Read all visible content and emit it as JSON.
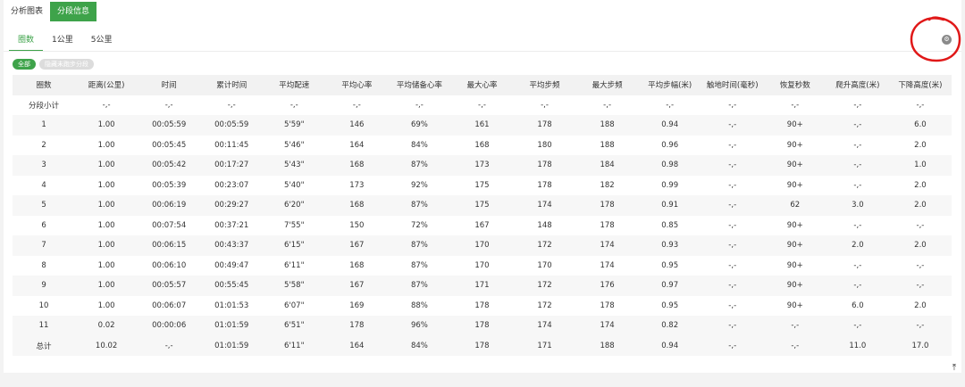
{
  "top_tabs": [
    {
      "label": "分析图表"
    },
    {
      "label": "分段信息"
    }
  ],
  "sub_tabs": [
    {
      "label": "圈数"
    },
    {
      "label": "1公里"
    },
    {
      "label": "5公里"
    }
  ],
  "chips": [
    {
      "label": "全部"
    },
    {
      "label": "隐藏未跑步分段"
    }
  ],
  "colors": {
    "accent": "#3ea34a",
    "annotation": "#e01818"
  },
  "icons": {
    "settings": "gear-icon",
    "scroll_top": "arrow-to-top-icon"
  },
  "table": {
    "headers": [
      "圈数",
      "距离(公里)",
      "时间",
      "累计时间",
      "平均配速",
      "平均心率",
      "平均储备心率",
      "最大心率",
      "平均步频",
      "最大步频",
      "平均步幅(米)",
      "触地时间(毫秒)",
      "恢复秒数",
      "爬升高度(米)",
      "下降高度(米)"
    ],
    "rows": [
      [
        "分段小计",
        "-,-",
        "-,-",
        "-,-",
        "-,-",
        "-,-",
        "-,-",
        "-,-",
        "-,-",
        "-,-",
        "-,-",
        "-,-",
        "-,-",
        "-,-",
        "-,-"
      ],
      [
        "1",
        "1.00",
        "00:05:59",
        "00:05:59",
        "5'59\"",
        "146",
        "69%",
        "161",
        "178",
        "188",
        "0.94",
        "-,-",
        "90+",
        "-,-",
        "6.0"
      ],
      [
        "2",
        "1.00",
        "00:05:45",
        "00:11:45",
        "5'46\"",
        "164",
        "84%",
        "168",
        "180",
        "188",
        "0.96",
        "-,-",
        "90+",
        "-,-",
        "2.0"
      ],
      [
        "3",
        "1.00",
        "00:05:42",
        "00:17:27",
        "5'43\"",
        "168",
        "87%",
        "173",
        "178",
        "184",
        "0.98",
        "-,-",
        "90+",
        "-,-",
        "1.0"
      ],
      [
        "4",
        "1.00",
        "00:05:39",
        "00:23:07",
        "5'40\"",
        "173",
        "92%",
        "175",
        "178",
        "182",
        "0.99",
        "-,-",
        "90+",
        "-,-",
        "2.0"
      ],
      [
        "5",
        "1.00",
        "00:06:19",
        "00:29:27",
        "6'20\"",
        "168",
        "87%",
        "175",
        "174",
        "178",
        "0.91",
        "-,-",
        "62",
        "3.0",
        "2.0"
      ],
      [
        "6",
        "1.00",
        "00:07:54",
        "00:37:21",
        "7'55\"",
        "150",
        "72%",
        "167",
        "148",
        "178",
        "0.85",
        "-,-",
        "90+",
        "-,-",
        "-,-"
      ],
      [
        "7",
        "1.00",
        "00:06:15",
        "00:43:37",
        "6'15\"",
        "167",
        "87%",
        "170",
        "172",
        "174",
        "0.93",
        "-,-",
        "90+",
        "2.0",
        "2.0"
      ],
      [
        "8",
        "1.00",
        "00:06:10",
        "00:49:47",
        "6'11\"",
        "168",
        "87%",
        "170",
        "170",
        "174",
        "0.95",
        "-,-",
        "90+",
        "-,-",
        "-,-"
      ],
      [
        "9",
        "1.00",
        "00:05:57",
        "00:55:45",
        "5'58\"",
        "167",
        "87%",
        "171",
        "172",
        "176",
        "0.97",
        "-,-",
        "90+",
        "-,-",
        "-,-"
      ],
      [
        "10",
        "1.00",
        "00:06:07",
        "01:01:53",
        "6'07\"",
        "169",
        "88%",
        "178",
        "172",
        "178",
        "0.95",
        "-,-",
        "90+",
        "6.0",
        "2.0"
      ],
      [
        "11",
        "0.02",
        "00:00:06",
        "01:01:59",
        "6'51\"",
        "178",
        "96%",
        "178",
        "174",
        "174",
        "0.82",
        "-,-",
        "-,-",
        "-,-",
        "-,-"
      ],
      [
        "总计",
        "10.02",
        "-,-",
        "01:01:59",
        "6'11\"",
        "164",
        "84%",
        "178",
        "171",
        "188",
        "0.94",
        "-,-",
        "-,-",
        "11.0",
        "17.0"
      ]
    ]
  }
}
